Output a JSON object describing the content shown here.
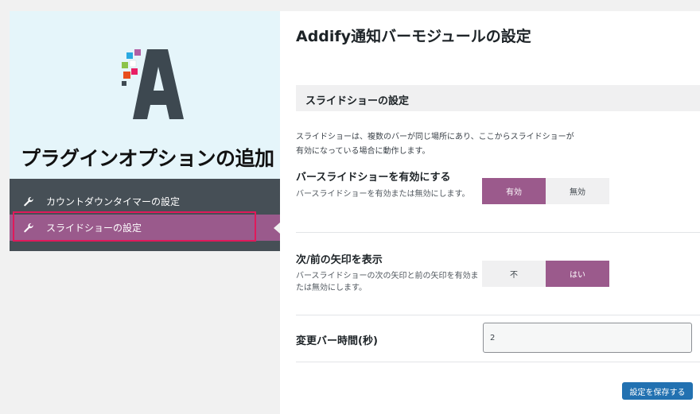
{
  "sidebar": {
    "title": "プラグインオプションの追加",
    "items": [
      {
        "label": "カウントダウンタイマーの設定",
        "icon": "wrench-icon"
      },
      {
        "label": "スライドショーの設定",
        "icon": "wrench-icon",
        "active": true
      }
    ]
  },
  "main": {
    "title": "Addify通知バーモジュールの設定",
    "section_title": "スライドショーの設定",
    "section_desc_line1": "スライドショーは、複数のバーが同じ場所にあり、ここからスライドショーが",
    "section_desc_line2": "有効になっている場合に動作します。",
    "rows": [
      {
        "label": "バースライドショーを有効にする",
        "desc": "バースライドショーを有効または無効にします。",
        "options": [
          "有効",
          "無効"
        ],
        "selected": "有効"
      },
      {
        "label": "次/前の矢印を表示",
        "desc": "バースライドショーの次の矢印と前の矢印を有効または無効にします。",
        "options": [
          "不",
          "はい"
        ],
        "selected": "はい"
      },
      {
        "label": "変更バー時間(秒)",
        "value": "2"
      }
    ],
    "save_label": "設定を保存する"
  },
  "colors": {
    "accent": "#9b5a8c",
    "primary_button": "#2271b1",
    "sidebar_bg": "#e5f5fa",
    "menu_bg": "#464f56",
    "highlight_border": "#e0195a"
  }
}
